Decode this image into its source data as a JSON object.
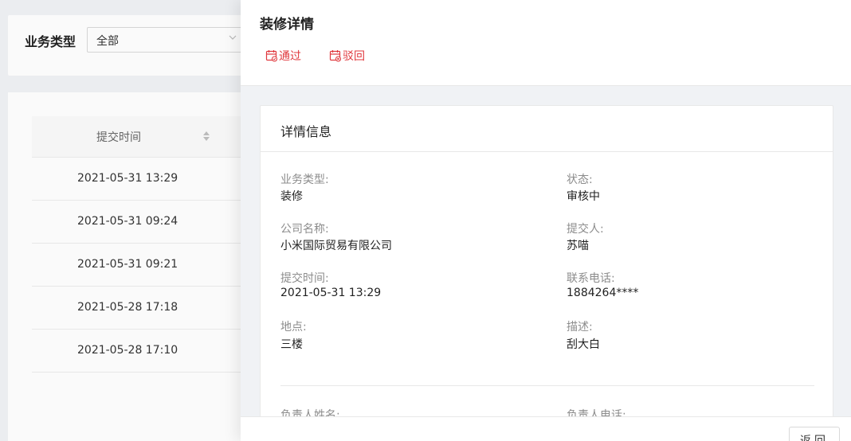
{
  "filter": {
    "label": "业务类型",
    "select_value": "全部"
  },
  "table": {
    "column_header": "提交时间",
    "rows": [
      "2021-05-31 13:29",
      "2021-05-31 09:24",
      "2021-05-31 09:21",
      "2021-05-28 17:18",
      "2021-05-28 17:10"
    ]
  },
  "drawer": {
    "title": "装修详情",
    "approve_label": "通过",
    "reject_label": "驳回",
    "section_title": "详情信息",
    "fields": {
      "business_type": {
        "label": "业务类型:",
        "value": "装修"
      },
      "status": {
        "label": "状态:",
        "value": "审核中"
      },
      "company": {
        "label": "公司名称:",
        "value": "小米国际贸易有限公司"
      },
      "submitter": {
        "label": "提交人:",
        "value": "苏喵"
      },
      "submit_time": {
        "label": "提交时间:",
        "value": "2021-05-31 13:29"
      },
      "phone": {
        "label": "联系电话:",
        "value": "1884264****"
      },
      "location": {
        "label": "地点:",
        "value": "三楼"
      },
      "description": {
        "label": "描述:",
        "value": "刮大白"
      },
      "manager_name": {
        "label": "负责人姓名:"
      },
      "manager_phone": {
        "label": "负责人电话:"
      }
    },
    "back_label": "返回"
  },
  "colors": {
    "action_red": "#e0393e",
    "background": "#f0f2f5"
  },
  "icons": {
    "approve": "calendar-check-icon",
    "reject": "calendar-x-icon",
    "select": "chevron-down-icon",
    "sort": "sort-icon"
  }
}
